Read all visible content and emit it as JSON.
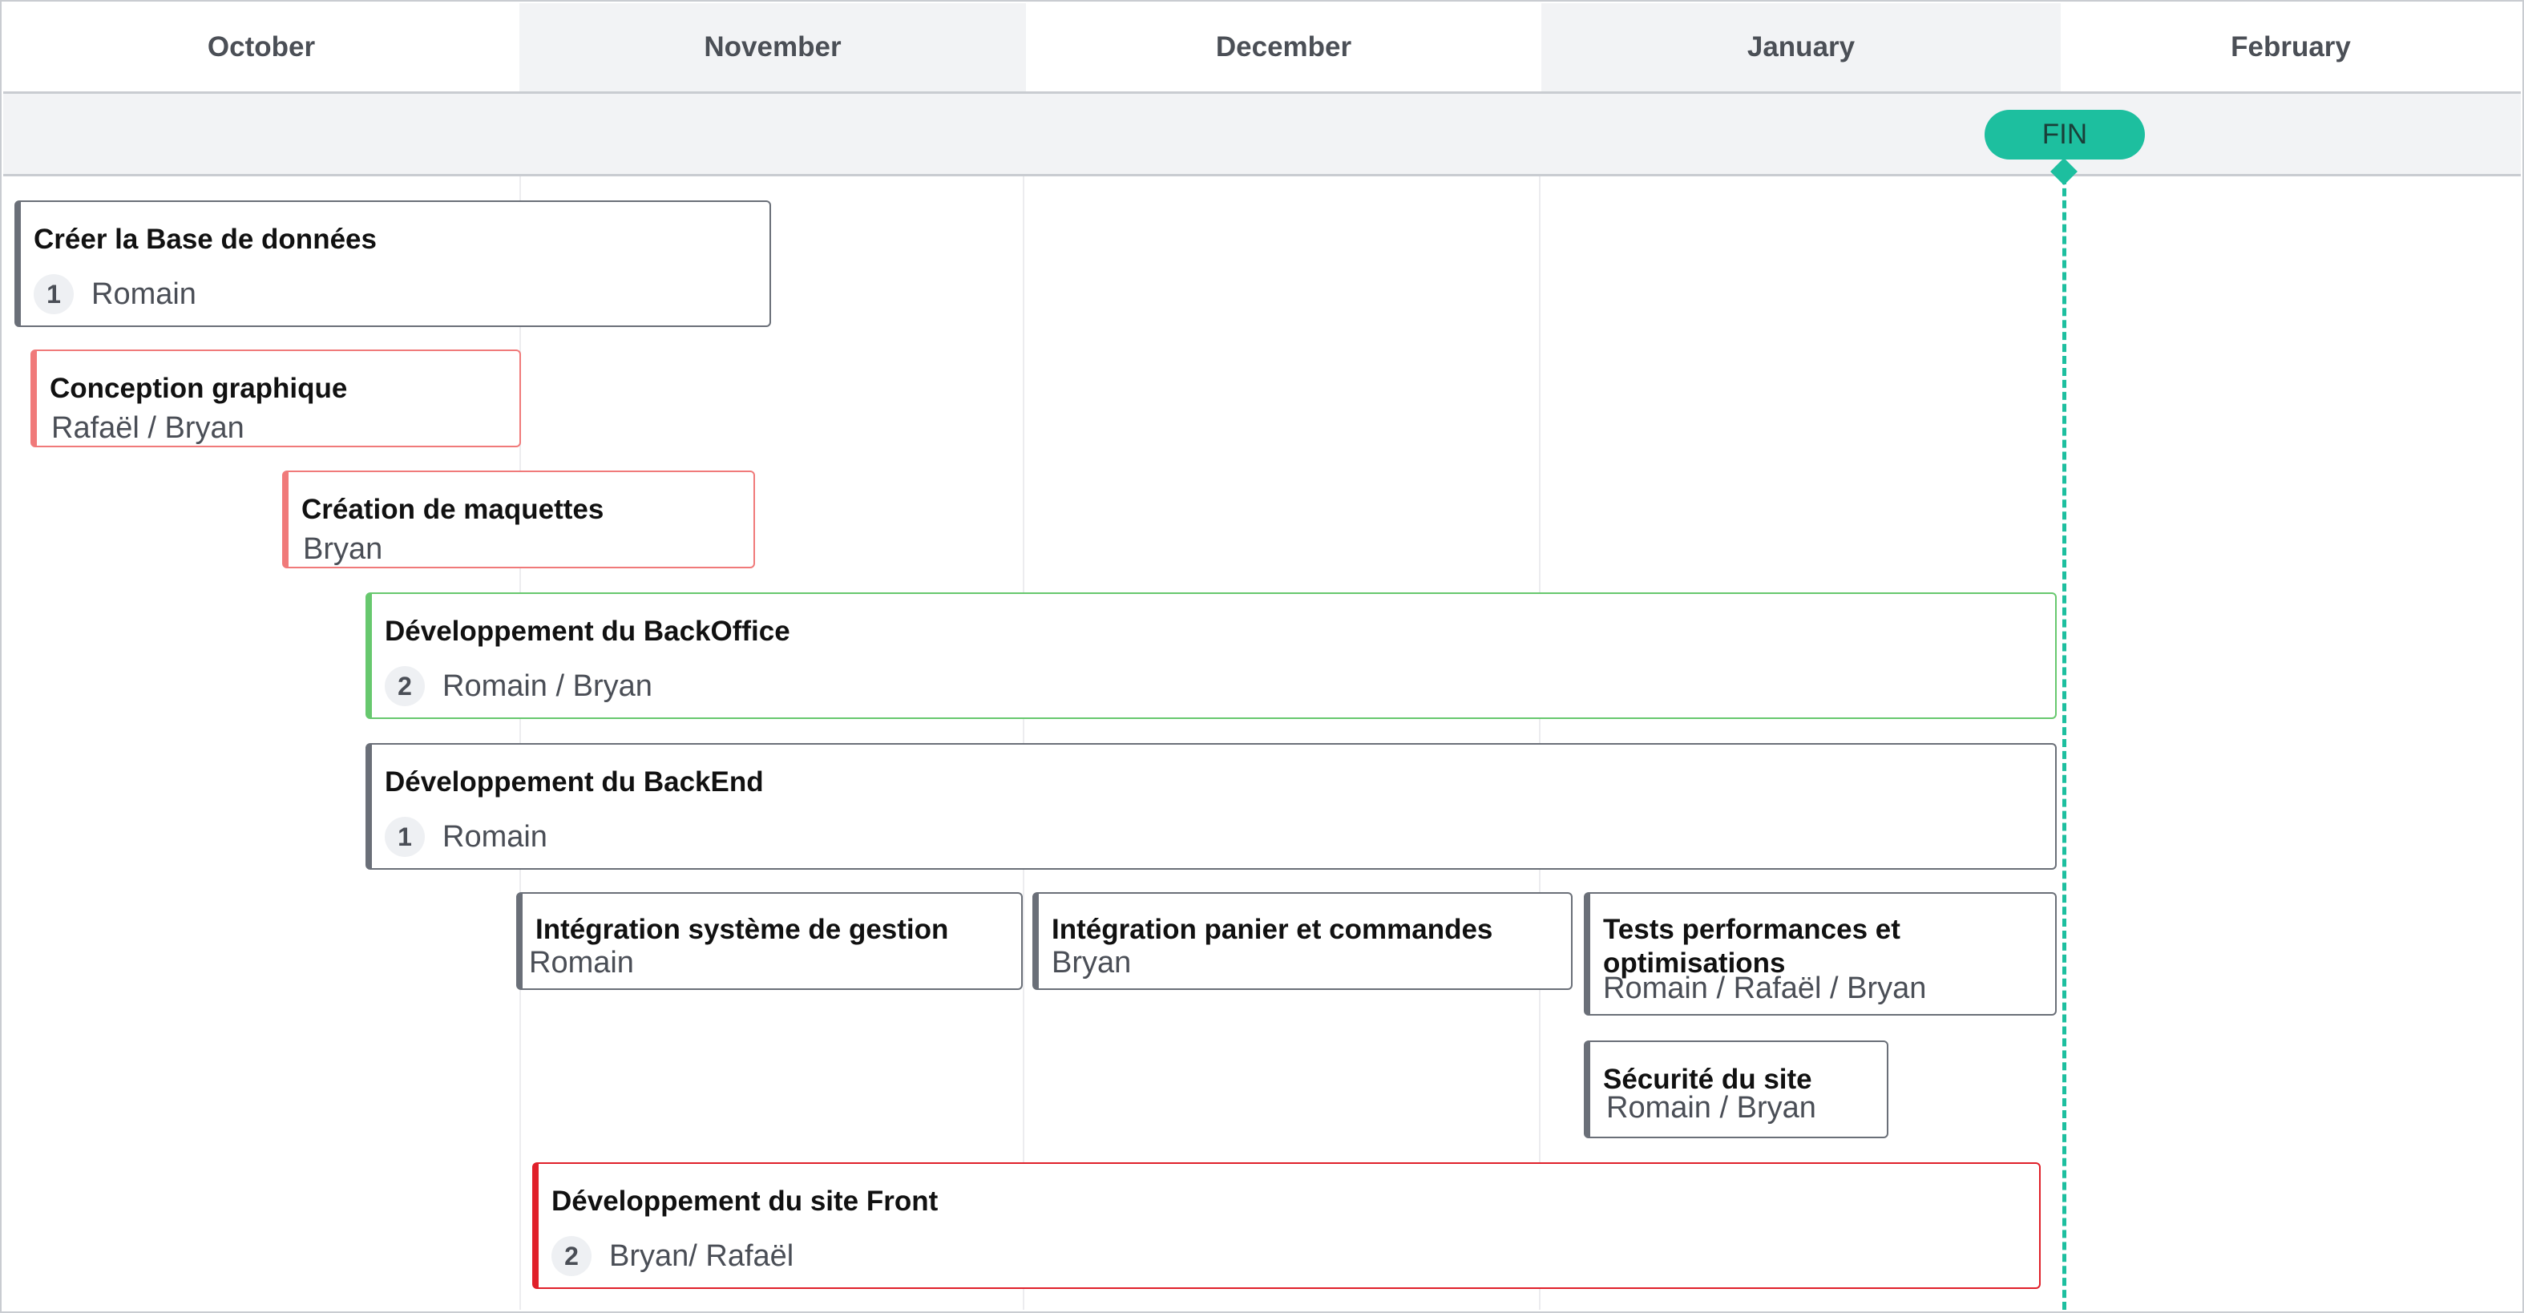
{
  "months": [
    "October",
    "November",
    "December",
    "January",
    "February"
  ],
  "milestone": {
    "label": "FIN"
  },
  "tasks": [
    {
      "title": "Créer la Base de données",
      "count": "1",
      "people": "Romain"
    },
    {
      "title": "Conception graphique",
      "people": "Rafaël / Bryan"
    },
    {
      "title": "Création de maquettes",
      "people": "Bryan"
    },
    {
      "title": "Développement du BackOffice",
      "count": "2",
      "people": "Romain / Bryan"
    },
    {
      "title": "Développement du BackEnd",
      "count": "1",
      "people": "Romain"
    },
    {
      "title": "Intégration système de gestion",
      "people": "Romain"
    },
    {
      "title": "Intégration panier et commandes",
      "people": "Bryan"
    },
    {
      "title": "Tests performances et optimisations",
      "people": "Romain / Rafaël / Bryan"
    },
    {
      "title": "Sécurité du site",
      "people": "Romain / Bryan"
    },
    {
      "title": "Développement du site Front",
      "count": "2",
      "people": "Bryan/ Rafaël"
    }
  ],
  "colors": {
    "milestone": "#1dbf9f",
    "task_default": "#6a6f78",
    "task_design": "#f07a7a",
    "task_backoffice": "#67c86e",
    "task_front": "#e0202a"
  }
}
